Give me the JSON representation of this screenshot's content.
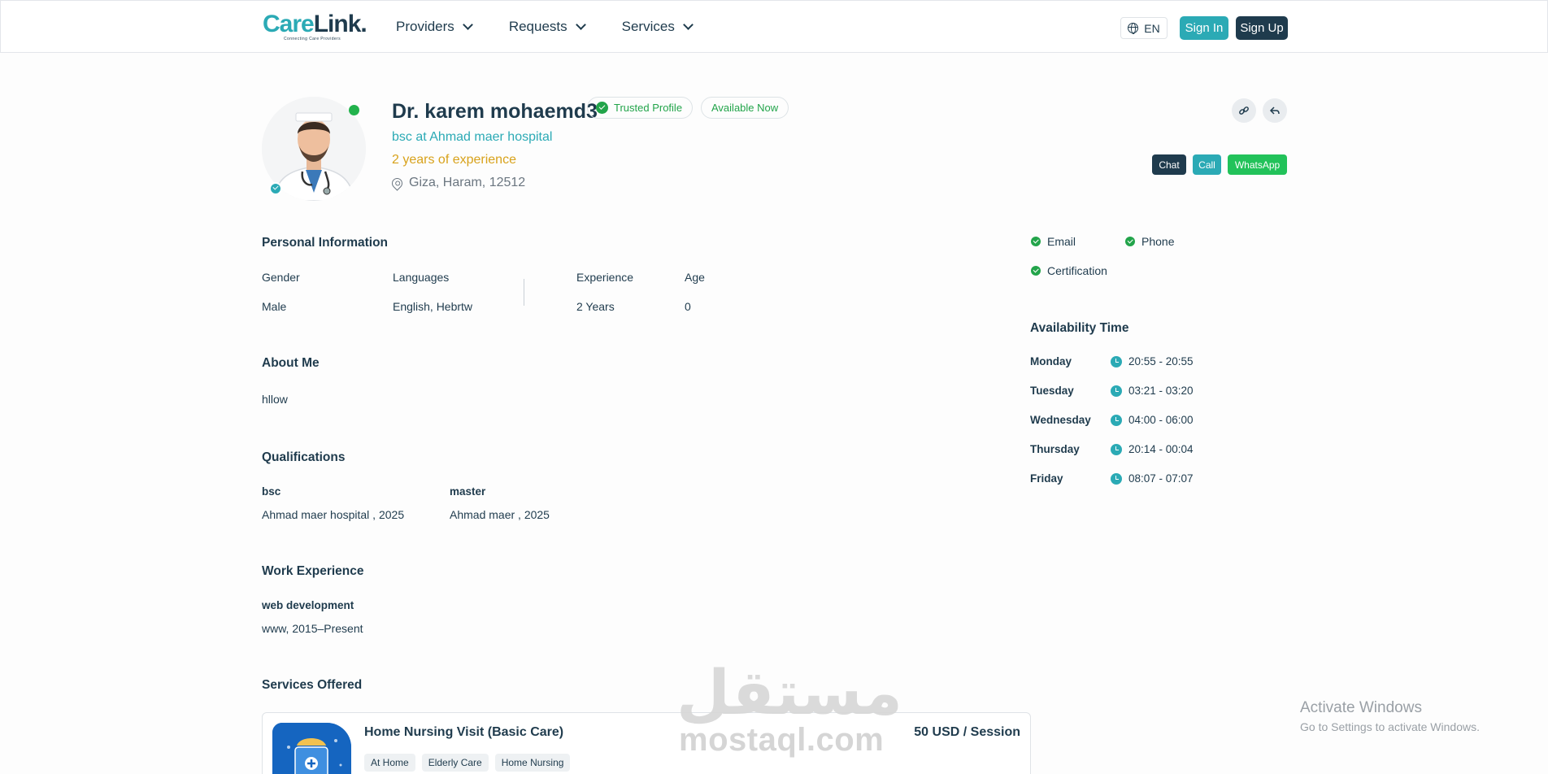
{
  "header": {
    "logo_text_a": "Care",
    "logo_text_b": "Link.",
    "logo_tagline": "Connecting Care Providers",
    "nav": [
      {
        "label": "Providers"
      },
      {
        "label": "Requests"
      },
      {
        "label": "Services"
      }
    ],
    "language": "EN",
    "sign_in": "Sign In",
    "sign_up": "Sign Up"
  },
  "profile": {
    "name": "Dr. karem mohaemd3",
    "trusted_badge": "Trusted Profile",
    "available_badge": "Available Now",
    "subtitle": "bsc at Ahmad maer hospital",
    "experience": "2 years of experience",
    "location": "Giza, Haram, 12512",
    "actions": {
      "chat": "Chat",
      "call": "Call",
      "whatsapp": "WhatsApp"
    }
  },
  "personal_info": {
    "title": "Personal Information",
    "fields": [
      {
        "label": "Gender",
        "value": "Male"
      },
      {
        "label": "Languages",
        "value": "English, Hebrtw"
      },
      {
        "label": "Experience",
        "value": "2 Years"
      },
      {
        "label": "Age",
        "value": "0"
      }
    ]
  },
  "about": {
    "title": "About Me",
    "text": "hllow"
  },
  "qualifications": {
    "title": "Qualifications",
    "items": [
      {
        "degree": "bsc",
        "detail": "Ahmad maer hospital , 2025"
      },
      {
        "degree": "master",
        "detail": "Ahmad maer , 2025"
      }
    ]
  },
  "work_experience": {
    "title": "Work Experience",
    "items": [
      {
        "role": "web development",
        "detail": "www, 2015–Present"
      }
    ]
  },
  "services": {
    "title": "Services Offered",
    "items": [
      {
        "title": "Home Nursing Visit (Basic Care)",
        "price": "50 USD / Session",
        "tags": [
          "At Home",
          "Elderly Care",
          "Home Nursing"
        ]
      }
    ]
  },
  "verifications": [
    "Email",
    "Phone",
    "Certification"
  ],
  "availability": {
    "title": "Availability Time",
    "days": [
      {
        "day": "Monday",
        "time": "20:55 - 20:55"
      },
      {
        "day": "Tuesday",
        "time": "03:21 - 03:20"
      },
      {
        "day": "Wednesday",
        "time": "04:00 - 06:00"
      },
      {
        "day": "Thursday",
        "time": "20:14 - 00:04"
      },
      {
        "day": "Friday",
        "time": "08:07 - 07:07"
      }
    ]
  },
  "watermark": {
    "arabic": "مستقل",
    "latin": "mostaql.com"
  },
  "windows_activation": {
    "line1": "Activate Windows",
    "line2": "Go to Settings to activate Windows."
  },
  "colors": {
    "primary": "#2baab5",
    "dark": "#1f3b4d",
    "success": "#22b24c",
    "gold": "#d8a21b"
  }
}
